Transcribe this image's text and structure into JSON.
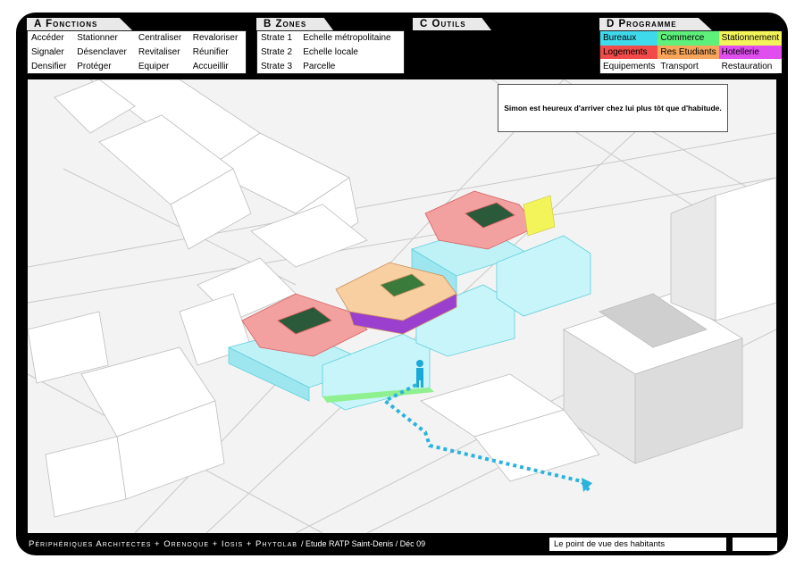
{
  "sections": {
    "a": {
      "title": "A Fonctions"
    },
    "b": {
      "title": "B Zones"
    },
    "c": {
      "title": "C Outils"
    },
    "d": {
      "title": "D Programme"
    }
  },
  "fonctions": [
    [
      "Accéder",
      "Stationner",
      "Centraliser",
      "Revaloriser"
    ],
    [
      "Signaler",
      "Désenclaver",
      "Revitaliser",
      "Réunifier"
    ],
    [
      "Densifier",
      "Protéger",
      "Equiper",
      "Accueillir"
    ]
  ],
  "zones": [
    [
      "Strate 1",
      "Echelle métropolitaine"
    ],
    [
      "Strate 2",
      "Echelle locale"
    ],
    [
      "Strate 3",
      "Parcelle"
    ]
  ],
  "programme": [
    [
      {
        "label": "Bureaux",
        "color": "#3fd9ec"
      },
      {
        "label": "Commerce",
        "color": "#5df07a"
      },
      {
        "label": "Stationnement",
        "color": "#f3f35a"
      }
    ],
    [
      {
        "label": "Logements",
        "color": "#f24a4a"
      },
      {
        "label": "Res Etudiants",
        "color": "#f6a55a"
      },
      {
        "label": "Hotellerie",
        "color": "#e04ef0"
      }
    ],
    [
      {
        "label": "Equipements",
        "color": "#ffffff"
      },
      {
        "label": "Transport",
        "color": "#ffffff"
      },
      {
        "label": "Restauration",
        "color": "#ffffff"
      }
    ]
  ],
  "speech": "Simon est heureux d'arriver chez lui plus tôt que d'habitude.",
  "footer": {
    "credits": "Périphériques Architectes + Orenoque + Iosis + Phytolab",
    "study": "/ Etude RATP Saint-Denis / Déc 09",
    "caption": "Le point de vue des habitants"
  }
}
